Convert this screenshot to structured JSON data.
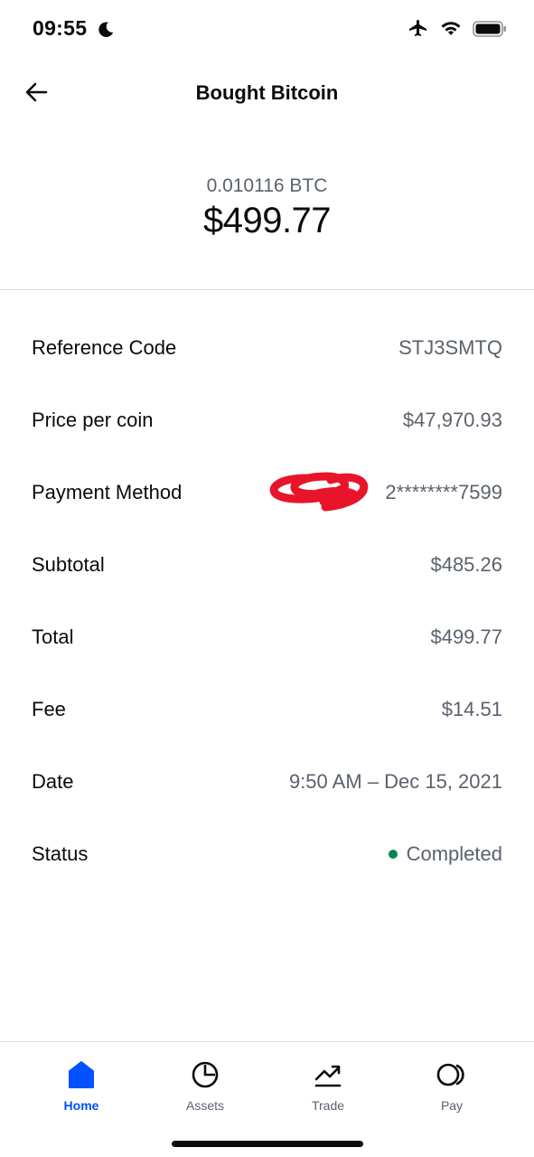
{
  "status_bar": {
    "time": "09:55",
    "icons": [
      "moon-icon",
      "airplane-icon",
      "wifi-icon",
      "battery-icon"
    ]
  },
  "nav": {
    "title": "Bought Bitcoin",
    "back_icon": "arrow-left-icon"
  },
  "summary": {
    "crypto_amount": "0.010116 BTC",
    "fiat_amount": "$499.77"
  },
  "details": [
    {
      "label": "Reference Code",
      "value": "STJ3SMTQ"
    },
    {
      "label": "Price per coin",
      "value": "$47,970.93"
    },
    {
      "label": "Payment Method",
      "value": "2********7599"
    },
    {
      "label": "Subtotal",
      "value": "$485.26"
    },
    {
      "label": "Total",
      "value": "$499.77"
    },
    {
      "label": "Fee",
      "value": "$14.51"
    },
    {
      "label": "Date",
      "value": "9:50 AM – Dec 15, 2021"
    },
    {
      "label": "Status",
      "value": "Completed"
    }
  ],
  "tabs": [
    {
      "label": "Home",
      "icon": "home-icon",
      "active": true
    },
    {
      "label": "Assets",
      "icon": "pie-chart-icon",
      "active": false
    },
    {
      "label": "Trade",
      "icon": "trend-up-icon",
      "active": false
    },
    {
      "label": "Pay",
      "icon": "pay-icon",
      "active": false
    }
  ],
  "colors": {
    "accent": "#0052ff",
    "status_completed": "#098551",
    "secondary_text": "#5b616e",
    "redaction_scribble": "#e8152a"
  }
}
